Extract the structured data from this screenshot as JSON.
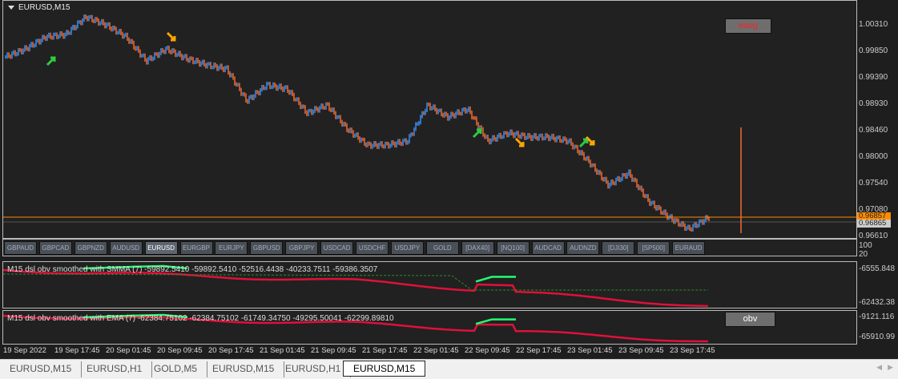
{
  "chart": {
    "title": "EURUSD,M15",
    "eavg_button": "eavg",
    "price_axis": [
      "1.00310",
      "0.99850",
      "0.99390",
      "0.98930",
      "0.98460",
      "0.98000",
      "0.97540",
      "0.97080",
      "0.96610"
    ],
    "bid_tag": "0.96857",
    "last_tag": "0.96865",
    "colors": {
      "up": "#3b8df0",
      "down": "#f06a30",
      "hline": "#ff8c00"
    },
    "price_path": [
      0.99763,
      0.99904,
      1.00114,
      1.00156,
      1.00464,
      1.00324,
      1.00114,
      0.99693,
      0.99904,
      0.99735,
      0.99623,
      0.99553,
      0.98993,
      0.99273,
      0.99203,
      0.98782,
      0.98922,
      0.98502,
      0.98222,
      0.98222,
      0.98292,
      0.98922,
      0.98712,
      0.98852,
      0.98292,
      0.98432,
      0.98362,
      0.98362,
      0.98292,
      0.97941,
      0.97521,
      0.97731,
      0.97241,
      0.9696,
      0.9675,
      0.9696
    ]
  },
  "symbol_buttons": [
    "GBPAUD",
    "GBPCAD",
    "GBPNZD",
    "AUDUSD",
    "EURUSD",
    "EURGBP",
    "EURJPY",
    "GBPUSD",
    "GBPJPY",
    "USDCAD",
    "USDCHF",
    "USDJPY",
    "GOLD",
    "[DAX40]",
    "[NQ100]",
    "AUDCAD",
    "AUDNZD",
    "[DJI30]",
    "[SP500]",
    "EURAUD"
  ],
  "active_symbol": "EURUSD",
  "btnbar_axis": [
    "100",
    "20"
  ],
  "sub1": {
    "label": "M15 dsl obv smoothed with SMMA (7) -59892.5410 -59892.5410 -52516.4438 -40233.7511 -59386.3507",
    "axis": [
      "-6555.848",
      "-62432.38"
    ]
  },
  "sub2": {
    "label": "M15 dsl obv smoothed with EMA (7) -62384.75102 -62384.75102 -61749.34750 -49295.50041 -62299.89810",
    "axis": [
      "-9121.116",
      "-65910.99"
    ],
    "obv_button": "obv"
  },
  "time_axis": [
    "19 Sep 2022",
    "19 Sep 17:45",
    "20 Sep 01:45",
    "20 Sep 09:45",
    "20 Sep 17:45",
    "21 Sep 01:45",
    "21 Sep 09:45",
    "21 Sep 17:45",
    "22 Sep 01:45",
    "22 Sep 09:45",
    "22 Sep 17:45",
    "23 Sep 01:45",
    "23 Sep 09:45",
    "23 Sep 17:45"
  ],
  "tabs": [
    "EURUSD,M15",
    "EURUSD,H1",
    "GOLD,M5",
    "EURUSD,M15",
    "EURUSD,H1",
    "EURUSD,M15"
  ],
  "active_tab": 5
}
